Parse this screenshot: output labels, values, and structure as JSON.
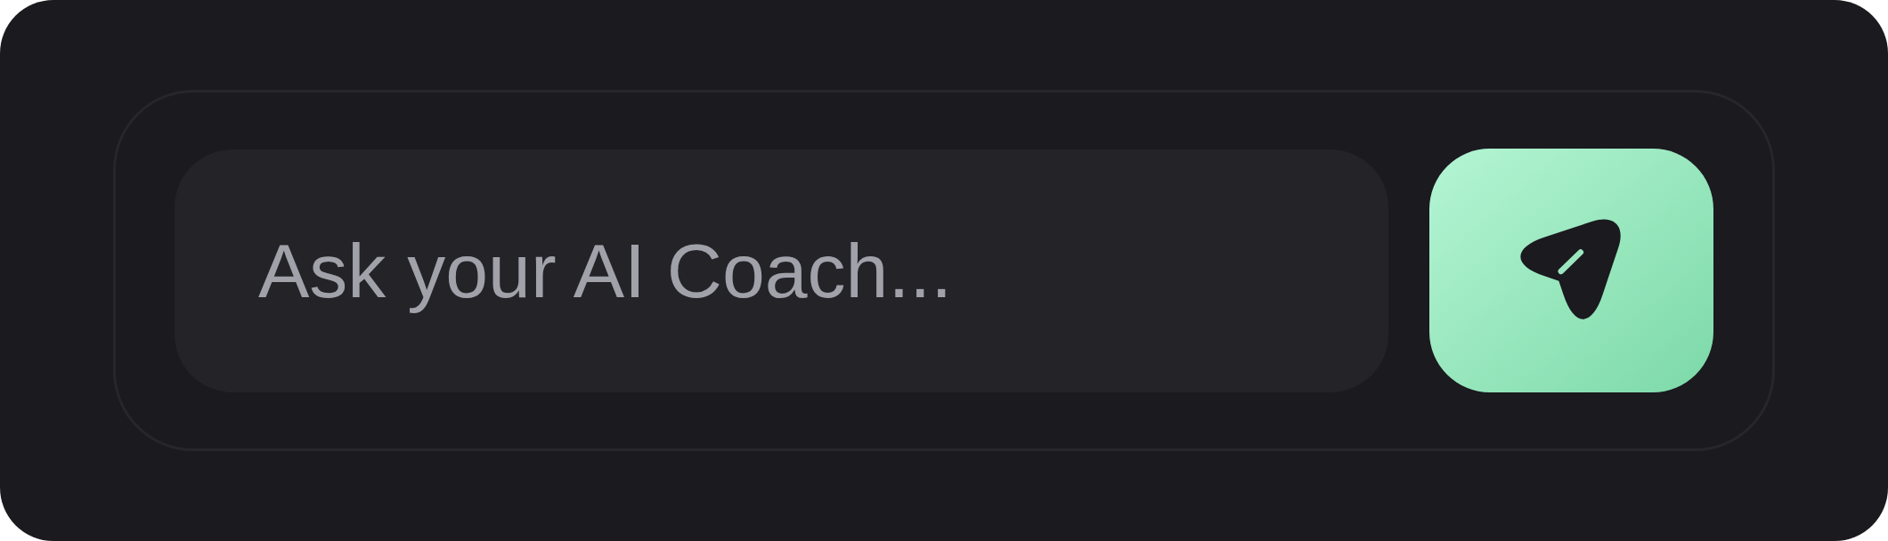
{
  "input": {
    "placeholder": "Ask your AI Coach..."
  }
}
